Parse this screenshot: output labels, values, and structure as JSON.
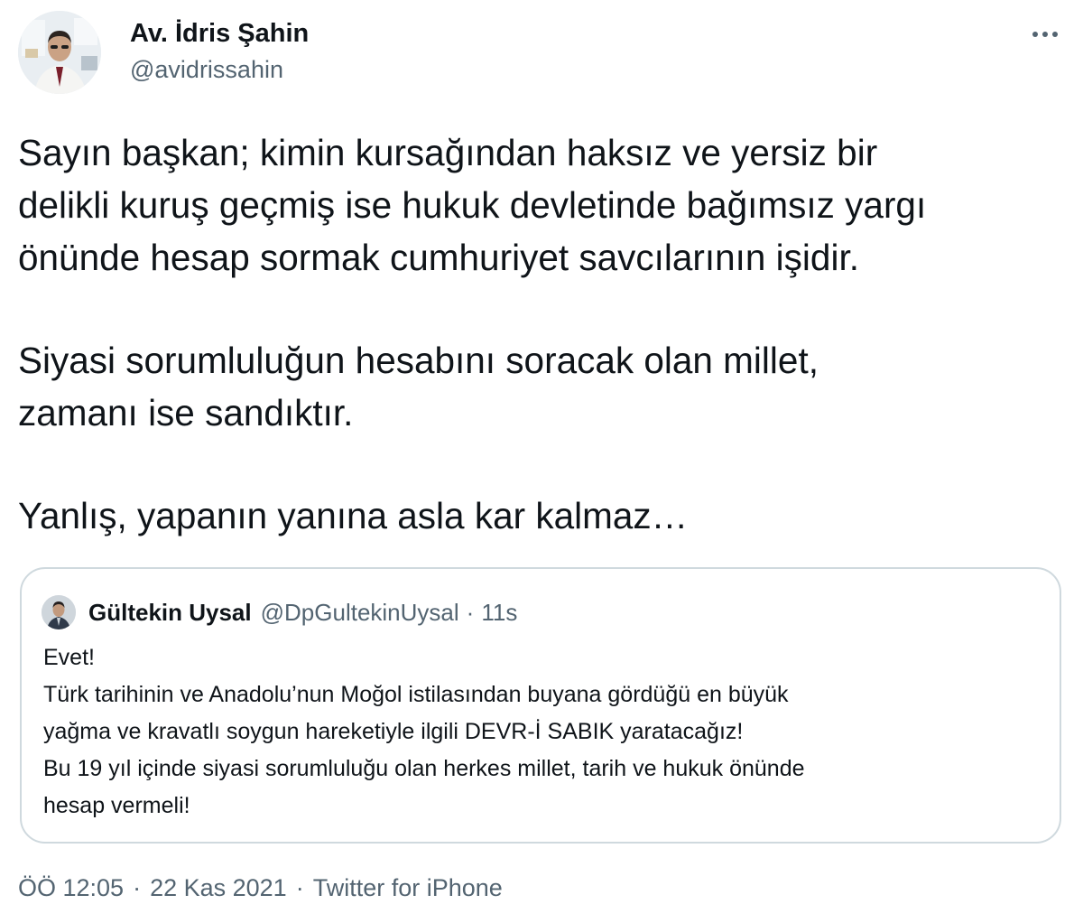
{
  "author": {
    "display_name": "Av. İdris Şahin",
    "handle": "@avidrissahin"
  },
  "more_icon": "ellipsis-icon",
  "tweet": {
    "lines": [
      "Sayın başkan; kimin kursağından haksız ve yersiz bir",
      "delikli kuruş geçmiş ise hukuk devletinde bağımsız yargı",
      "önünde hesap sormak cumhuriyet savcılarının işidir.",
      "Siyasi sorumluluğun hesabını soracak olan millet,",
      "zamanı ise sandıktır.",
      "Yanlış, yapanın yanına asla kar kalmaz…"
    ]
  },
  "quoted": {
    "display_name": "Gültekin Uysal",
    "handle": "@DpGultekinUysal",
    "separator": "·",
    "time": "11s",
    "lines": [
      "Evet!",
      "Türk tarihinin ve Anadolu’nun Moğol istilasından buyana gördüğü en büyük",
      "yağma ve kravatlı soygun hareketiyle ilgili DEVR-İ SABIK yaratacağız!",
      "Bu 19 yıl içinde siyasi sorumluluğu olan herkes millet, tarih ve hukuk önünde",
      "hesap vermeli!"
    ]
  },
  "meta": {
    "time": "ÖÖ 12:05",
    "separator": "·",
    "date": "22 Kas 2021",
    "source": "Twitter for iPhone"
  },
  "colors": {
    "text": "#0f1419",
    "secondary": "#536471",
    "border": "#cfd9de"
  }
}
